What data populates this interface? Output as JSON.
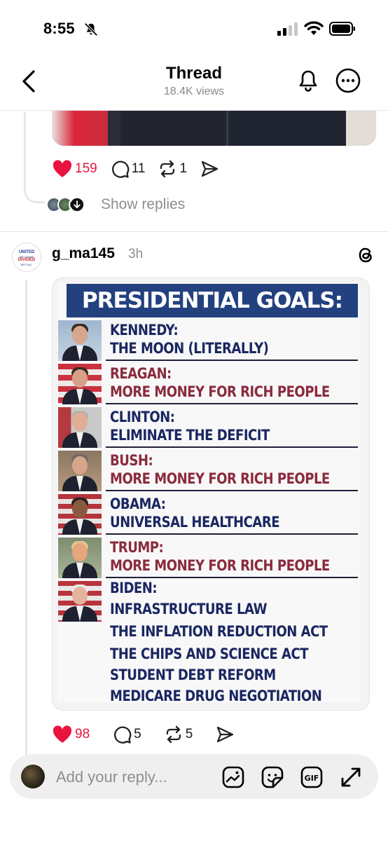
{
  "status_bar": {
    "time": "8:55"
  },
  "header": {
    "title": "Thread",
    "subtitle": "18.4K views"
  },
  "previous_post": {
    "likes": "159",
    "comments": "11",
    "reposts": "1",
    "show_replies_label": "Show replies"
  },
  "post": {
    "avatar_text": [
      "UNITED",
      "WE STAND",
      "DIVIDED",
      "WE FALL"
    ],
    "username": "g_ma145",
    "time": "3h",
    "meme": {
      "title": "PRESIDENTIAL GOALS:",
      "rows": [
        {
          "name": "KENNEDY:",
          "goals": [
            "THE MOON (LITERALLY)"
          ],
          "color": "blue"
        },
        {
          "name": "REAGAN:",
          "goals": [
            "MORE MONEY FOR RICH PEOPLE"
          ],
          "color": "red"
        },
        {
          "name": "CLINTON:",
          "goals": [
            "ELIMINATE THE DEFICIT"
          ],
          "color": "blue"
        },
        {
          "name": "BUSH:",
          "goals": [
            "MORE MONEY FOR RICH PEOPLE"
          ],
          "color": "red"
        },
        {
          "name": "OBAMA:",
          "goals": [
            "UNIVERSAL HEALTHCARE"
          ],
          "color": "blue"
        },
        {
          "name": "TRUMP:",
          "goals": [
            "MORE MONEY FOR RICH PEOPLE"
          ],
          "color": "red"
        },
        {
          "name": "BIDEN:",
          "goals": [
            "INFRASTRUCTURE LAW",
            "THE INFLATION REDUCTION ACT",
            "THE CHIPS AND SCIENCE ACT",
            "STUDENT DEBT REFORM",
            "MEDICARE DRUG NEGOTIATION"
          ],
          "color": "blue"
        }
      ]
    },
    "likes": "98",
    "comments": "5",
    "reposts": "5"
  },
  "reply_bar": {
    "placeholder": "Add your reply...",
    "gif_label": "GIF"
  },
  "colors": {
    "like_red": "#e8143f",
    "meme_blue": "#1a2761",
    "meme_red": "#8a2b3e",
    "meme_banner": "#23417f"
  }
}
